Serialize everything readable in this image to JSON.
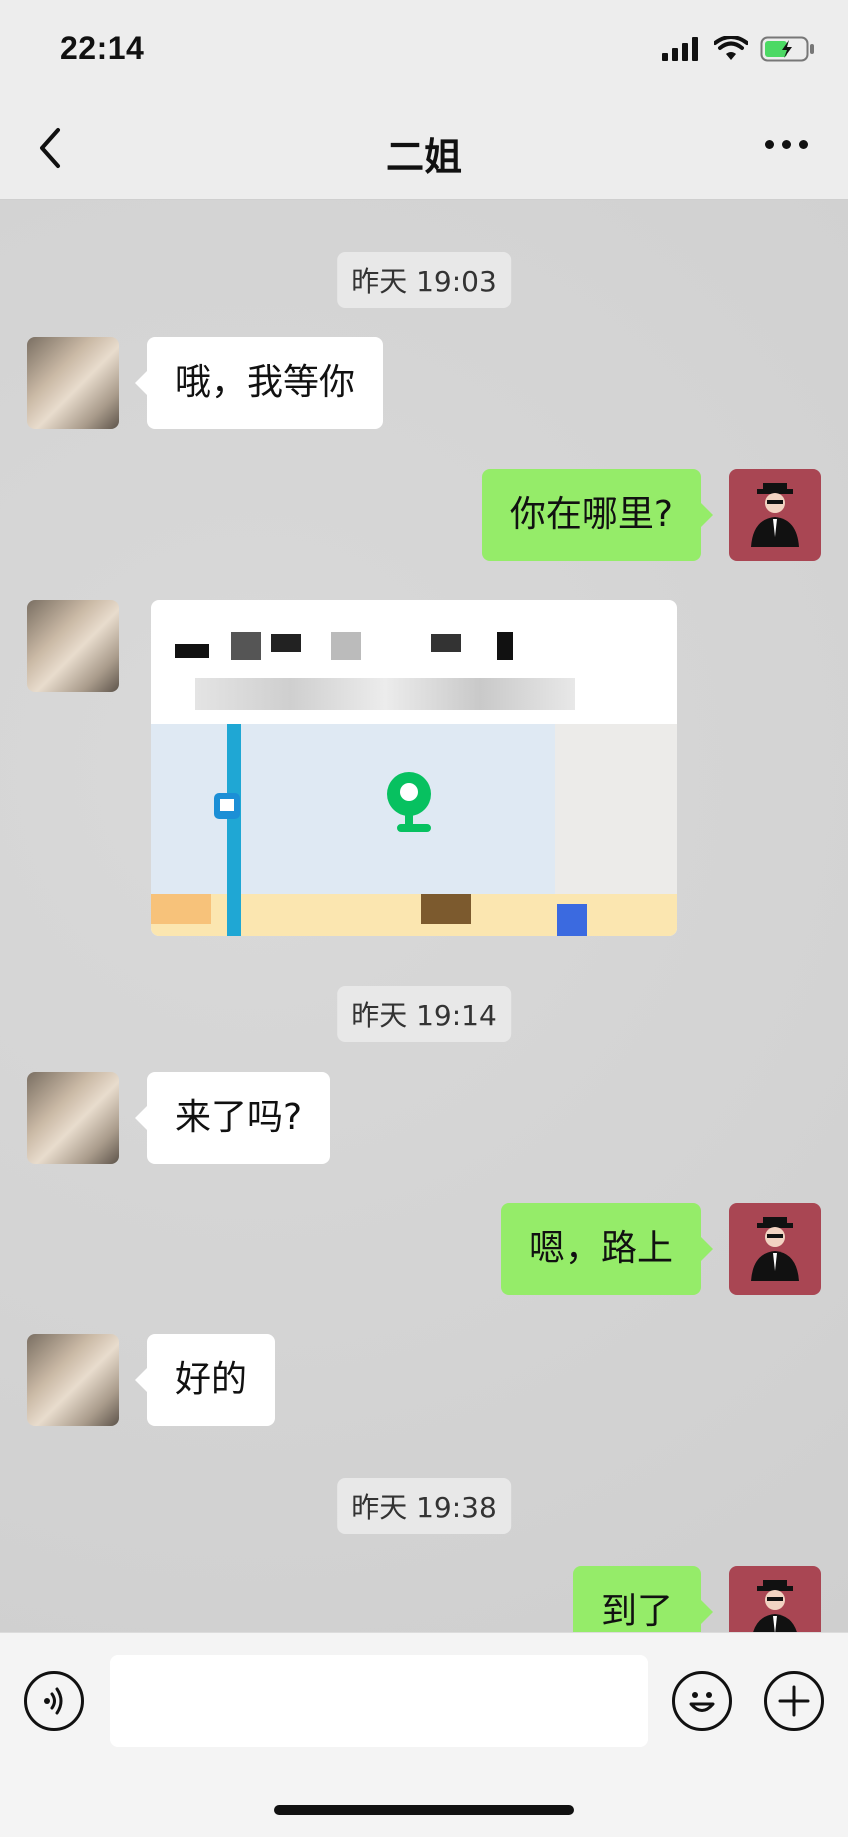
{
  "status_bar": {
    "time": "22:14",
    "battery_color": "#4cd964"
  },
  "nav": {
    "title": "二姐"
  },
  "messages": [
    {
      "type": "timestamp",
      "text": "昨天 19:03"
    },
    {
      "type": "text",
      "from": "her",
      "text": "哦，我等你"
    },
    {
      "type": "text",
      "from": "me",
      "text": "你在哪里?"
    },
    {
      "type": "location",
      "from": "her"
    },
    {
      "type": "timestamp",
      "text": "昨天 19:14"
    },
    {
      "type": "text",
      "from": "her",
      "text": "来了吗?"
    },
    {
      "type": "text",
      "from": "me",
      "text": "嗯，路上"
    },
    {
      "type": "text",
      "from": "her",
      "text": "好的"
    },
    {
      "type": "timestamp",
      "text": "昨天 19:38"
    },
    {
      "type": "text",
      "from": "me",
      "text": "到了"
    }
  ],
  "input_bar": {
    "value": "",
    "placeholder": ""
  },
  "colors": {
    "bubble_out": "#95ec69",
    "bubble_in": "#ffffff",
    "chat_bg": "#d6d6d6",
    "pin": "#07c160"
  },
  "icons": {
    "back": "chevron-left-icon",
    "more": "more-dots-icon",
    "voice": "voice-icon",
    "emoji": "emoji-icon",
    "add": "plus-icon"
  }
}
